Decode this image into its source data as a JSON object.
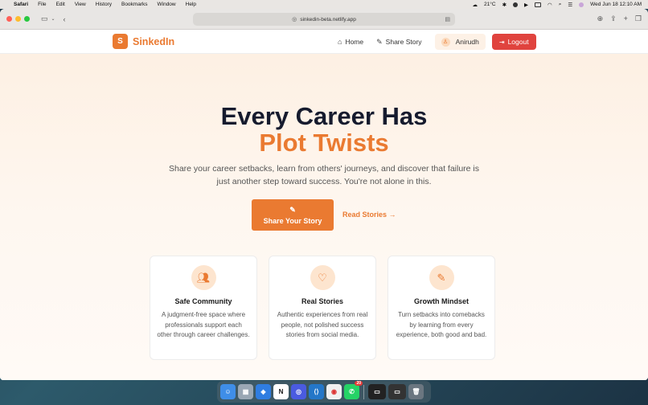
{
  "menubar": {
    "items": [
      "Safari",
      "File",
      "Edit",
      "View",
      "History",
      "Bookmarks",
      "Window",
      "Help"
    ],
    "weather": "21°C",
    "datetime": "Wed Jun 18  12:10 AM"
  },
  "browser": {
    "url": "sinkedin-beta.netlify.app"
  },
  "nav": {
    "logo_letter": "S",
    "brand": "SinkedIn",
    "home": "Home",
    "share": "Share Story",
    "user": "Anirudh",
    "logout": "Logout"
  },
  "hero": {
    "line1": "Every Career Has",
    "line2": "Plot Twists",
    "subtitle": "Share your career setbacks, learn from others' journeys, and discover that failure is just another step toward success. You're not alone in this.",
    "cta": "Share Your Story",
    "read": "Read Stories →"
  },
  "cards": [
    {
      "title": "Safe Community",
      "desc": "A judgment-free space where professionals support each other through career challenges."
    },
    {
      "title": "Real Stories",
      "desc": "Authentic experiences from real people, not polished success stories from social media."
    },
    {
      "title": "Growth Mindset",
      "desc": "Turn setbacks into comebacks by learning from every experience, both good and bad."
    }
  ],
  "colors": {
    "accent": "#ea7a31",
    "logout": "#e0433e",
    "heading": "#161b2e"
  },
  "dock": {
    "badge": "20"
  }
}
